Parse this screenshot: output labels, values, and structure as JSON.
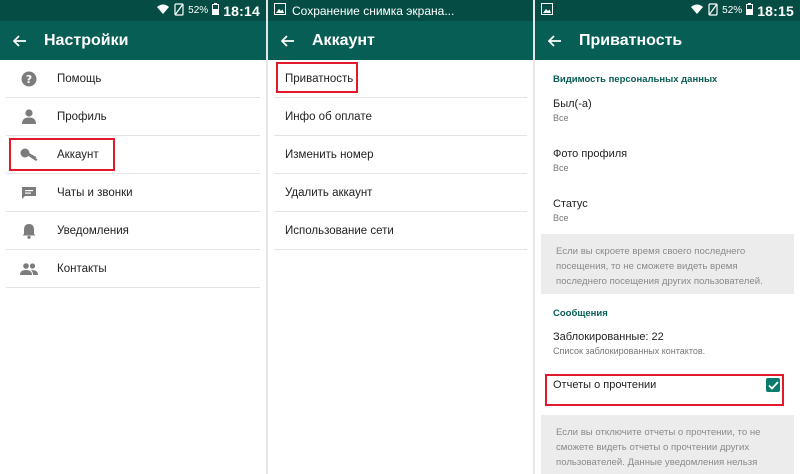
{
  "status": {
    "left_time": "18:14",
    "right_time": "18:15",
    "battery": "52%",
    "notification": "Сохранение снимка экрана..."
  },
  "settings": {
    "title": "Настройки",
    "items": [
      {
        "label": "Помощь",
        "icon": "help-icon"
      },
      {
        "label": "Профиль",
        "icon": "person-icon"
      },
      {
        "label": "Аккаунт",
        "icon": "key-icon"
      },
      {
        "label": "Чаты и звонки",
        "icon": "chat-icon"
      },
      {
        "label": "Уведомления",
        "icon": "bell-icon"
      },
      {
        "label": "Контакты",
        "icon": "contacts-icon"
      }
    ]
  },
  "account": {
    "title": "Аккаунт",
    "items": [
      "Приватность",
      "Инфо об оплате",
      "Изменить номер",
      "Удалить аккаунт",
      "Использование сети"
    ]
  },
  "privacy": {
    "title": "Приватность",
    "section_visibility": "Видимость персональных данных",
    "last_seen": {
      "title": "Был(-а)",
      "value": "Все"
    },
    "profile_photo": {
      "title": "Фото профиля",
      "value": "Все"
    },
    "status": {
      "title": "Статус",
      "value": "Все"
    },
    "info_last_seen": "Если вы скроете время своего последнего посещения, то не сможете видеть время последнего посещения других пользователей.",
    "section_messages": "Сообщения",
    "blocked": {
      "title": "Заблокированные: 22",
      "subtitle": "Список заблокированных контактов."
    },
    "read_receipts": {
      "title": "Отчеты о прочтении",
      "checked": true
    },
    "info_read_receipts": "Если вы отключите отчеты о прочтении, то не сможете видеть отчеты о прочтении других пользователей. Данные уведомления нельзя отключить для групповых чатов."
  },
  "colors": {
    "statusbar": "#054d44",
    "appbar": "#075e54",
    "accent": "#075e54",
    "highlight": "#e2182b",
    "checkbox": "#0a7a6d"
  }
}
